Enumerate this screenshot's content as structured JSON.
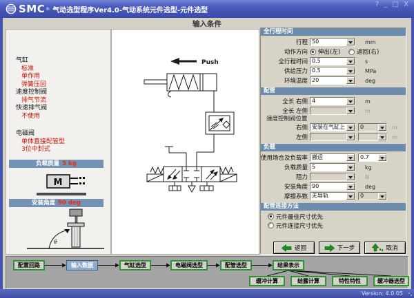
{
  "window": {
    "brand": "SMC",
    "reg_mark": "®",
    "title": "气动选型程序Ver4.0-气动系统元件选型-元件选型",
    "controls": {
      "help": "?",
      "minimize": "_",
      "maximize": "□",
      "close": "X"
    },
    "page_title": "输入条件",
    "version": "Version: 4.0.05"
  },
  "sidebar": {
    "groups": [
      {
        "label": "气缸",
        "items": [
          "标准",
          "单作用",
          "弹簧压回"
        ]
      },
      {
        "label": "速度控制阀",
        "items": [
          "排气节流"
        ]
      },
      {
        "label": "快速排气阀",
        "items": [
          "不使用"
        ]
      },
      {
        "label": "电磁阀",
        "items": [
          "单体直接配管型",
          "3位中封式"
        ]
      }
    ],
    "load_mass": {
      "title": "负载质量",
      "value": "5 kg",
      "block_label": "M"
    },
    "mount_angle": {
      "title": "安装角度",
      "value": "90 deg",
      "angle_symbol": "θ"
    }
  },
  "diagram": {
    "push_label": "Push"
  },
  "form": {
    "sections": {
      "stroke_time": {
        "title": "全行程时间",
        "stroke": {
          "label": "行程",
          "value": "50",
          "unit": "mm"
        },
        "direction": {
          "label": "动作方向",
          "options": [
            "伸出(左)",
            "返回(右)"
          ],
          "selected": "伸出(左)"
        },
        "full_time": {
          "label": "全行程时间",
          "value": "0.5",
          "unit": "s"
        },
        "pressure": {
          "label": "供给压力",
          "value": "0.5",
          "unit": "MPa"
        },
        "temperature": {
          "label": "环境温度",
          "value": "20",
          "unit": "deg"
        }
      },
      "piping": {
        "title": "配管",
        "len_right": {
          "label": "全长 右侧",
          "value": "4",
          "unit": "m"
        },
        "len_left": {
          "label": "全长 左侧",
          "value": "",
          "unit": "m"
        },
        "valve_pos_label": "速度控制阀位置",
        "pos_right": {
          "label": "右侧",
          "value": "安装在气缸上",
          "value2": "0",
          "unit": "m"
        },
        "pos_left": {
          "label": "左侧",
          "value": "",
          "value2": "",
          "unit": "m"
        }
      },
      "load": {
        "title": "负载",
        "usage": {
          "label": "使用场合及负载率",
          "value": "搬运",
          "value2": "0.7"
        },
        "mass": {
          "label": "负载质量",
          "value": "5",
          "unit": "kg"
        },
        "resistance": {
          "label": "阻力",
          "value": "",
          "unit": "N"
        },
        "angle": {
          "label": "安装角度",
          "value": "90",
          "unit": "deg"
        },
        "friction": {
          "label": "摩擦系数",
          "value": "无导轨",
          "value2": "0"
        }
      },
      "pipe_connect": {
        "title": "配管连接方法",
        "options": [
          "元件最佳尺寸优先",
          "元件连接尺寸优先"
        ],
        "selected": "元件最佳尺寸优先"
      }
    },
    "buttons": {
      "back": "返回",
      "next": "下一步",
      "cancel": "取消"
    }
  },
  "flow": {
    "steps": [
      "配置回路",
      "输入数据",
      "气缸选型",
      "电磁阀选型",
      "配管选型",
      "结果表示"
    ],
    "active_step": "输入数据",
    "sub_steps": [
      "缓冲计算",
      "结露计算",
      "特性特性",
      "缓冲器选型"
    ]
  },
  "colors": {
    "titlebar": "#4254b0",
    "section_header": "#6d8cab",
    "sidebar_header": "#7492b2",
    "accent_red": "#c81400",
    "button_green": "#1e8b22",
    "active_step": "#8fabca"
  }
}
